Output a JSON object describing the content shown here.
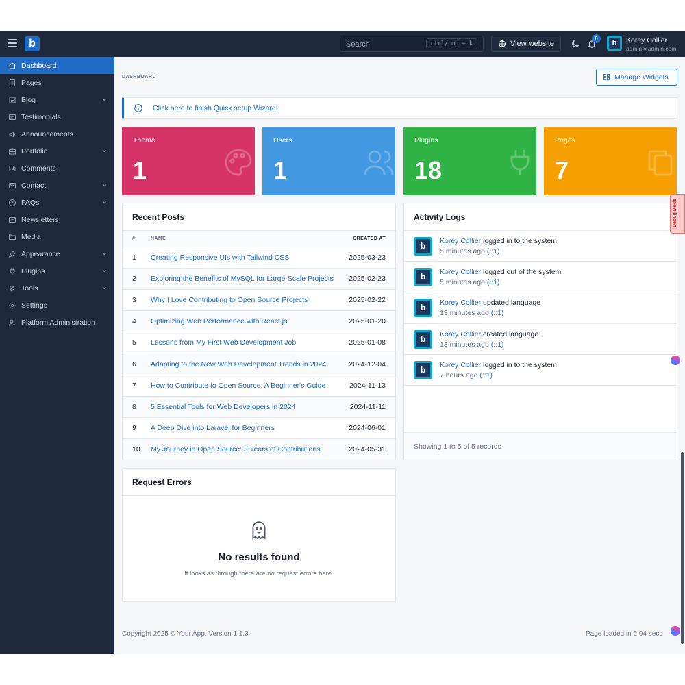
{
  "app": {
    "logo_letter": "b",
    "brand_color": "#206bc4",
    "sidebar_color": "#1e293b"
  },
  "topbar": {
    "search_placeholder": "Search",
    "search_shortcut": "ctrl/cmd + k",
    "view_website_label": "View website",
    "notification_count": "0",
    "user_name": "Korey Collier",
    "user_email": "admin@admin.com"
  },
  "sidebar": {
    "items": [
      {
        "label": "Dashboard",
        "icon": "home-icon",
        "active": true,
        "has_children": false
      },
      {
        "label": "Pages",
        "icon": "pages-icon",
        "active": false,
        "has_children": false
      },
      {
        "label": "Blog",
        "icon": "blog-icon",
        "active": false,
        "has_children": true
      },
      {
        "label": "Testimonials",
        "icon": "testimonials-icon",
        "active": false,
        "has_children": false
      },
      {
        "label": "Announcements",
        "icon": "megaphone-icon",
        "active": false,
        "has_children": false
      },
      {
        "label": "Portfolio",
        "icon": "briefcase-icon",
        "active": false,
        "has_children": true
      },
      {
        "label": "Comments",
        "icon": "comments-icon",
        "active": false,
        "has_children": false
      },
      {
        "label": "Contact",
        "icon": "mail-icon",
        "active": false,
        "has_children": true
      },
      {
        "label": "FAQs",
        "icon": "help-icon",
        "active": false,
        "has_children": true
      },
      {
        "label": "Newsletters",
        "icon": "newsletter-icon",
        "active": false,
        "has_children": false
      },
      {
        "label": "Media",
        "icon": "folder-icon",
        "active": false,
        "has_children": false
      },
      {
        "label": "Appearance",
        "icon": "brush-icon",
        "active": false,
        "has_children": true
      },
      {
        "label": "Plugins",
        "icon": "plug-icon",
        "active": false,
        "has_children": true
      },
      {
        "label": "Tools",
        "icon": "tools-icon",
        "active": false,
        "has_children": true
      },
      {
        "label": "Settings",
        "icon": "gear-icon",
        "active": false,
        "has_children": false
      },
      {
        "label": "Platform Administration",
        "icon": "user-cog-icon",
        "active": false,
        "has_children": false
      }
    ]
  },
  "page": {
    "breadcrumb": "DASHBOARD",
    "manage_widgets_label": "Manage Widgets",
    "alert_link": "Click here",
    "alert_text": " to finish Quick setup Wizard!"
  },
  "stats": [
    {
      "label": "Theme",
      "value": "1",
      "color": "#d63369",
      "icon": "palette-icon"
    },
    {
      "label": "Users",
      "value": "1",
      "color": "#4299e1",
      "icon": "users-icon"
    },
    {
      "label": "Plugins",
      "value": "18",
      "color": "#2fb344",
      "icon": "plug-icon"
    },
    {
      "label": "Pages",
      "value": "7",
      "color": "#f59f00",
      "icon": "copy-icon"
    }
  ],
  "recent_posts": {
    "title": "Recent Posts",
    "columns": [
      "#",
      "NAME",
      "CREATED AT"
    ],
    "rows": [
      {
        "num": "1",
        "name": "Creating Responsive UIs with Tailwind CSS",
        "created": "2025-03-23"
      },
      {
        "num": "2",
        "name": "Exploring the Benefits of MySQL for Large-Scale Projects",
        "created": "2025-02-23"
      },
      {
        "num": "3",
        "name": "Why I Love Contributing to Open Source Projects",
        "created": "2025-02-22"
      },
      {
        "num": "4",
        "name": "Optimizing Web Performance with React.js",
        "created": "2025-01-20"
      },
      {
        "num": "5",
        "name": "Lessons from My First Web Development Job",
        "created": "2025-01-08"
      },
      {
        "num": "6",
        "name": "Adapting to the New Web Development Trends in 2024",
        "created": "2024-12-04"
      },
      {
        "num": "7",
        "name": "How to Contribute to Open Source: A Beginner's Guide",
        "created": "2024-11-13"
      },
      {
        "num": "8",
        "name": "5 Essential Tools for Web Developers in 2024",
        "created": "2024-11-11"
      },
      {
        "num": "9",
        "name": "A Deep Dive into Laravel for Beginners",
        "created": "2024-06-01"
      },
      {
        "num": "10",
        "name": "My Journey in Open Source: 3 Years of Contributions",
        "created": "2024-05-31"
      }
    ]
  },
  "activity_logs": {
    "title": "Activity Logs",
    "items": [
      {
        "user": "Korey Collier",
        "action": " logged in to the system",
        "time": "5 minutes ago",
        "ip": "(::1)"
      },
      {
        "user": "Korey Collier",
        "action": " logged out of the system",
        "time": "5 minutes ago",
        "ip": "(::1)"
      },
      {
        "user": "Korey Collier",
        "action": " updated language",
        "time": "13 minutes ago",
        "ip": "(::1)"
      },
      {
        "user": "Korey Collier",
        "action": " created language",
        "time": "13 minutes ago",
        "ip": "(::1)"
      },
      {
        "user": "Korey Collier",
        "action": " logged in to the system",
        "time": "7 hours ago",
        "ip": "(::1)"
      }
    ],
    "footer": "Showing 1 to 5 of 5 records"
  },
  "request_errors": {
    "title": "Request Errors",
    "empty_title": "No results found",
    "empty_text": "It looks as through there are no request errors here."
  },
  "footer": {
    "copyright": "Copyright 2025 © Your App. Version 1.1.3",
    "page_loaded": "Page loaded in 2.04 seco"
  },
  "debug_tab_label": "Debug Mode"
}
